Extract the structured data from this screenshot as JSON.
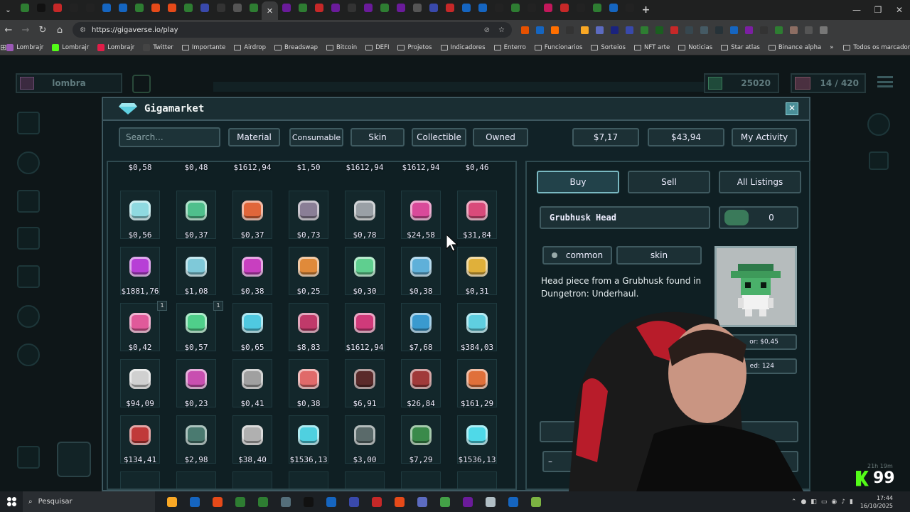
{
  "browser": {
    "url": "https://gigaverse.io/play",
    "bookmarks": [
      "Lombrajr",
      "Lombrajr",
      "Lombrajr",
      "Twitter",
      "Importante",
      "Airdrop",
      "Breadswap",
      "Bitcoin",
      "DEFI",
      "Projetos",
      "Indicadores",
      "Enterro",
      "Funcionarios",
      "Sorteios",
      "NFT arte",
      "Noticias",
      "Star atlas",
      "Binance alpha"
    ],
    "bookmarks_more": "»",
    "all_bookmarks": "Todos os marcadores"
  },
  "hud": {
    "player_name": "lombra",
    "gold": "25020",
    "energy": "14 / 420"
  },
  "market": {
    "title": "Gigamarket",
    "search_placeholder": "Search...",
    "filters": [
      "Material",
      "Consumable",
      "Skin",
      "Collectible",
      "Owned"
    ],
    "balance_1": "$7,17",
    "balance_2": "$43,94",
    "my_activity": "My Activity",
    "close": "✕",
    "top_row_prices": [
      "$0,58",
      "$0,48",
      "$1612,94",
      "$1,50",
      "$1612,94",
      "$1612,94",
      "$0,46"
    ],
    "items": [
      {
        "price": "$0,56",
        "color": "#8fd9e0"
      },
      {
        "price": "$0,37",
        "color": "#4fbf8c"
      },
      {
        "price": "$0,37",
        "color": "#e0663a"
      },
      {
        "price": "$0,73",
        "color": "#8a7e96"
      },
      {
        "price": "$0,78",
        "color": "#9aa0a6"
      },
      {
        "price": "$24,58",
        "color": "#d94a9a"
      },
      {
        "price": "$31,84",
        "color": "#d94a7a"
      },
      {
        "price": "$1881,76",
        "color": "#b73fd6"
      },
      {
        "price": "$1,08",
        "color": "#7fc9d9"
      },
      {
        "price": "$0,38",
        "color": "#c83fc0"
      },
      {
        "price": "$0,25",
        "color": "#e08a3a"
      },
      {
        "price": "$0,30",
        "color": "#5fcf8f"
      },
      {
        "price": "$0,38",
        "color": "#5fb0d9"
      },
      {
        "price": "$0,31",
        "color": "#e0b03a"
      },
      {
        "price": "$0,42",
        "color": "#e05a9a",
        "qty": "1"
      },
      {
        "price": "$0,57",
        "color": "#4fcf8a",
        "qty": "1"
      },
      {
        "price": "$0,65",
        "color": "#4fc9e0"
      },
      {
        "price": "$8,83",
        "color": "#c03a6a"
      },
      {
        "price": "$1612,94",
        "color": "#d03a7a"
      },
      {
        "price": "$7,68",
        "color": "#3a9acf"
      },
      {
        "price": "$384,03",
        "color": "#5fcfe0"
      },
      {
        "price": "$94,09",
        "color": "#d0d0d0"
      },
      {
        "price": "$0,23",
        "color": "#c84fb0"
      },
      {
        "price": "$0,41",
        "color": "#a0a0a0"
      },
      {
        "price": "$0,38",
        "color": "#e06a6a"
      },
      {
        "price": "$6,91",
        "color": "#5a2a2a"
      },
      {
        "price": "$26,84",
        "color": "#a03a3a"
      },
      {
        "price": "$161,29",
        "color": "#e0703a"
      },
      {
        "price": "$134,41",
        "color": "#c03a3a"
      },
      {
        "price": "$2,98",
        "color": "#4a7a70"
      },
      {
        "price": "$38,40",
        "color": "#b0b0b0"
      },
      {
        "price": "$1536,13",
        "color": "#4fd0e0"
      },
      {
        "price": "$3,00",
        "color": "#5a6a6a"
      },
      {
        "price": "$7,29",
        "color": "#3a8a4a"
      },
      {
        "price": "$1536,13",
        "color": "#4fd9e8"
      }
    ],
    "detail": {
      "tabs": [
        "Buy",
        "Sell",
        "All Listings"
      ],
      "item_name": "Grubhusk Head",
      "owned_count": "0",
      "rarity": "common",
      "type": "skin",
      "description": "Head piece from a Grubhusk found in Dungetron: Underhaul.",
      "floor_partial": "or: $0,45",
      "listed_partial": "ed: 124",
      "qty_minus": "–"
    }
  },
  "overlay": {
    "counter": "99",
    "timer_partial": "21h 19m"
  },
  "taskbar": {
    "search": "Pesquisar",
    "time": "17:44",
    "date": "16/10/2025"
  }
}
